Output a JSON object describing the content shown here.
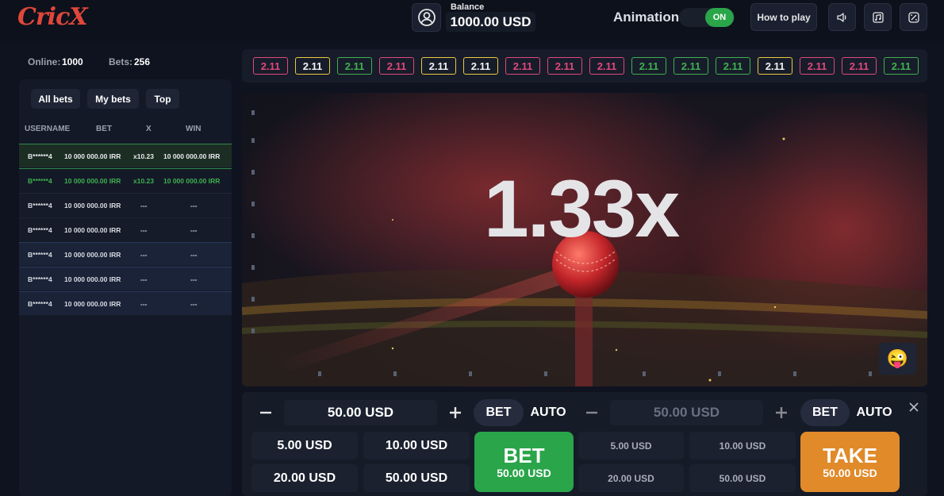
{
  "app": {
    "logo": "CricX"
  },
  "header": {
    "balance_label": "Balance",
    "balance_value": "1000.00 USD",
    "animation_label": "Animation",
    "animation_state": "ON",
    "how_to_play": "How to play"
  },
  "stats": {
    "online_label": "Online:",
    "online_value": "1000",
    "bets_label": "Bets:",
    "bets_value": "256"
  },
  "bets_panel": {
    "tabs": [
      "All bets",
      "My bets",
      "Top"
    ],
    "columns": [
      "USERNAME",
      "BET",
      "X",
      "WIN"
    ],
    "rows": [
      {
        "user": "B******4",
        "bet": "10 000 000.00 IRR",
        "x": "x10.23",
        "win": "10 000 000.00 IRR",
        "style": "win-white"
      },
      {
        "user": "B******4",
        "bet": "10 000 000.00 IRR",
        "x": "x10.23",
        "win": "10 000 000.00 IRR",
        "style": "win-green"
      },
      {
        "user": "B******4",
        "bet": "10 000 000.00 IRR",
        "x": "---",
        "win": "---",
        "style": "plain"
      },
      {
        "user": "B******4",
        "bet": "10 000 000.00 IRR",
        "x": "---",
        "win": "---",
        "style": "plain"
      },
      {
        "user": "B******4",
        "bet": "10 000 000.00 IRR",
        "x": "---",
        "win": "---",
        "style": "blue"
      },
      {
        "user": "B******4",
        "bet": "10 000 000.00 IRR",
        "x": "---",
        "win": "---",
        "style": "blue"
      },
      {
        "user": "B******4",
        "bet": "10 000 000.00 IRR",
        "x": "---",
        "win": "---",
        "style": "blue"
      }
    ]
  },
  "history": [
    {
      "value": "2.11",
      "color": "#e0487a"
    },
    {
      "value": "2.11",
      "color": "#e8c840"
    },
    {
      "value": "2.11",
      "color": "#3fb04f"
    },
    {
      "value": "2.11",
      "color": "#e0487a"
    },
    {
      "value": "2.11",
      "color": "#e8c840"
    },
    {
      "value": "2.11",
      "color": "#e8c840"
    },
    {
      "value": "2.11",
      "color": "#e0487a"
    },
    {
      "value": "2.11",
      "color": "#e0487a"
    },
    {
      "value": "2.11",
      "color": "#e0487a"
    },
    {
      "value": "2.11",
      "color": "#3fb04f"
    },
    {
      "value": "2.11",
      "color": "#3fb04f"
    },
    {
      "value": "2.11",
      "color": "#3fb04f"
    },
    {
      "value": "2.11",
      "color": "#e8c840"
    },
    {
      "value": "2.11",
      "color": "#e0487a"
    },
    {
      "value": "2.11",
      "color": "#e0487a"
    },
    {
      "value": "2.11",
      "color": "#3fb04f"
    }
  ],
  "game": {
    "multiplier": "1.33x",
    "emoji": "😜"
  },
  "panel1": {
    "amount": "50.00 USD",
    "mode_bet": "BET",
    "mode_auto": "AUTO",
    "quick": [
      "5.00 USD",
      "10.00 USD",
      "20.00 USD",
      "50.00 USD"
    ],
    "action_label": "BET",
    "action_amount": "50.00 USD"
  },
  "panel2": {
    "amount": "50.00 USD",
    "mode_bet": "BET",
    "mode_auto": "AUTO",
    "quick": [
      "5.00 USD",
      "10.00 USD",
      "20.00 USD",
      "50.00 USD"
    ],
    "action_label": "TAKE",
    "action_amount": "50.00 USD"
  },
  "colors": {
    "accent_green": "#2aa54a",
    "take_orange": "#e08a2a",
    "brand_red": "#e0473a"
  }
}
